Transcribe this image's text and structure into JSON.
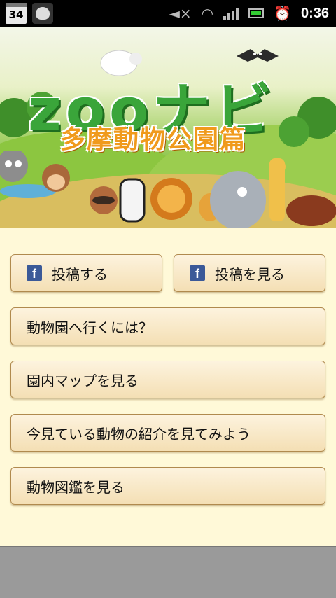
{
  "statusbar": {
    "calendar_day": "34",
    "time": "0:36"
  },
  "banner": {
    "title": "zooナビ",
    "subtitle": "多摩動物公園篇"
  },
  "buttons": {
    "post": "投稿する",
    "view_posts": "投稿を見る",
    "how_to_get": "動物園へ行くには？",
    "map": "園内マップを見る",
    "current_animal": "今見ている動物の紹介を見てみよう",
    "encyclopedia": "動物図鑑を見る"
  },
  "colors": {
    "facebook": "#3b5998",
    "button_bg": "#f4dfb4",
    "page_bg": "#fff9d8"
  }
}
